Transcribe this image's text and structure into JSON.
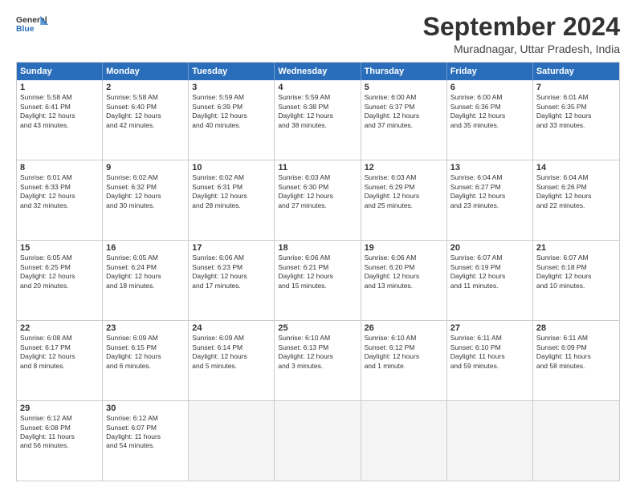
{
  "logo": {
    "line1": "General",
    "line2": "Blue"
  },
  "header": {
    "month": "September 2024",
    "location": "Muradnagar, Uttar Pradesh, India"
  },
  "days": [
    "Sunday",
    "Monday",
    "Tuesday",
    "Wednesday",
    "Thursday",
    "Friday",
    "Saturday"
  ],
  "weeks": [
    [
      {
        "day": "1",
        "lines": [
          "Sunrise: 5:58 AM",
          "Sunset: 6:41 PM",
          "Daylight: 12 hours",
          "and 43 minutes."
        ]
      },
      {
        "day": "2",
        "lines": [
          "Sunrise: 5:58 AM",
          "Sunset: 6:40 PM",
          "Daylight: 12 hours",
          "and 42 minutes."
        ]
      },
      {
        "day": "3",
        "lines": [
          "Sunrise: 5:59 AM",
          "Sunset: 6:39 PM",
          "Daylight: 12 hours",
          "and 40 minutes."
        ]
      },
      {
        "day": "4",
        "lines": [
          "Sunrise: 5:59 AM",
          "Sunset: 6:38 PM",
          "Daylight: 12 hours",
          "and 38 minutes."
        ]
      },
      {
        "day": "5",
        "lines": [
          "Sunrise: 6:00 AM",
          "Sunset: 6:37 PM",
          "Daylight: 12 hours",
          "and 37 minutes."
        ]
      },
      {
        "day": "6",
        "lines": [
          "Sunrise: 6:00 AM",
          "Sunset: 6:36 PM",
          "Daylight: 12 hours",
          "and 35 minutes."
        ]
      },
      {
        "day": "7",
        "lines": [
          "Sunrise: 6:01 AM",
          "Sunset: 6:35 PM",
          "Daylight: 12 hours",
          "and 33 minutes."
        ]
      }
    ],
    [
      {
        "day": "8",
        "lines": [
          "Sunrise: 6:01 AM",
          "Sunset: 6:33 PM",
          "Daylight: 12 hours",
          "and 32 minutes."
        ]
      },
      {
        "day": "9",
        "lines": [
          "Sunrise: 6:02 AM",
          "Sunset: 6:32 PM",
          "Daylight: 12 hours",
          "and 30 minutes."
        ]
      },
      {
        "day": "10",
        "lines": [
          "Sunrise: 6:02 AM",
          "Sunset: 6:31 PM",
          "Daylight: 12 hours",
          "and 28 minutes."
        ]
      },
      {
        "day": "11",
        "lines": [
          "Sunrise: 6:03 AM",
          "Sunset: 6:30 PM",
          "Daylight: 12 hours",
          "and 27 minutes."
        ]
      },
      {
        "day": "12",
        "lines": [
          "Sunrise: 6:03 AM",
          "Sunset: 6:29 PM",
          "Daylight: 12 hours",
          "and 25 minutes."
        ]
      },
      {
        "day": "13",
        "lines": [
          "Sunrise: 6:04 AM",
          "Sunset: 6:27 PM",
          "Daylight: 12 hours",
          "and 23 minutes."
        ]
      },
      {
        "day": "14",
        "lines": [
          "Sunrise: 6:04 AM",
          "Sunset: 6:26 PM",
          "Daylight: 12 hours",
          "and 22 minutes."
        ]
      }
    ],
    [
      {
        "day": "15",
        "lines": [
          "Sunrise: 6:05 AM",
          "Sunset: 6:25 PM",
          "Daylight: 12 hours",
          "and 20 minutes."
        ]
      },
      {
        "day": "16",
        "lines": [
          "Sunrise: 6:05 AM",
          "Sunset: 6:24 PM",
          "Daylight: 12 hours",
          "and 18 minutes."
        ]
      },
      {
        "day": "17",
        "lines": [
          "Sunrise: 6:06 AM",
          "Sunset: 6:23 PM",
          "Daylight: 12 hours",
          "and 17 minutes."
        ]
      },
      {
        "day": "18",
        "lines": [
          "Sunrise: 6:06 AM",
          "Sunset: 6:21 PM",
          "Daylight: 12 hours",
          "and 15 minutes."
        ]
      },
      {
        "day": "19",
        "lines": [
          "Sunrise: 6:06 AM",
          "Sunset: 6:20 PM",
          "Daylight: 12 hours",
          "and 13 minutes."
        ]
      },
      {
        "day": "20",
        "lines": [
          "Sunrise: 6:07 AM",
          "Sunset: 6:19 PM",
          "Daylight: 12 hours",
          "and 11 minutes."
        ]
      },
      {
        "day": "21",
        "lines": [
          "Sunrise: 6:07 AM",
          "Sunset: 6:18 PM",
          "Daylight: 12 hours",
          "and 10 minutes."
        ]
      }
    ],
    [
      {
        "day": "22",
        "lines": [
          "Sunrise: 6:08 AM",
          "Sunset: 6:17 PM",
          "Daylight: 12 hours",
          "and 8 minutes."
        ]
      },
      {
        "day": "23",
        "lines": [
          "Sunrise: 6:09 AM",
          "Sunset: 6:15 PM",
          "Daylight: 12 hours",
          "and 6 minutes."
        ]
      },
      {
        "day": "24",
        "lines": [
          "Sunrise: 6:09 AM",
          "Sunset: 6:14 PM",
          "Daylight: 12 hours",
          "and 5 minutes."
        ]
      },
      {
        "day": "25",
        "lines": [
          "Sunrise: 6:10 AM",
          "Sunset: 6:13 PM",
          "Daylight: 12 hours",
          "and 3 minutes."
        ]
      },
      {
        "day": "26",
        "lines": [
          "Sunrise: 6:10 AM",
          "Sunset: 6:12 PM",
          "Daylight: 12 hours",
          "and 1 minute."
        ]
      },
      {
        "day": "27",
        "lines": [
          "Sunrise: 6:11 AM",
          "Sunset: 6:10 PM",
          "Daylight: 11 hours",
          "and 59 minutes."
        ]
      },
      {
        "day": "28",
        "lines": [
          "Sunrise: 6:11 AM",
          "Sunset: 6:09 PM",
          "Daylight: 11 hours",
          "and 58 minutes."
        ]
      }
    ],
    [
      {
        "day": "29",
        "lines": [
          "Sunrise: 6:12 AM",
          "Sunset: 6:08 PM",
          "Daylight: 11 hours",
          "and 56 minutes."
        ]
      },
      {
        "day": "30",
        "lines": [
          "Sunrise: 6:12 AM",
          "Sunset: 6:07 PM",
          "Daylight: 11 hours",
          "and 54 minutes."
        ]
      },
      {
        "day": "",
        "lines": []
      },
      {
        "day": "",
        "lines": []
      },
      {
        "day": "",
        "lines": []
      },
      {
        "day": "",
        "lines": []
      },
      {
        "day": "",
        "lines": []
      }
    ]
  ]
}
